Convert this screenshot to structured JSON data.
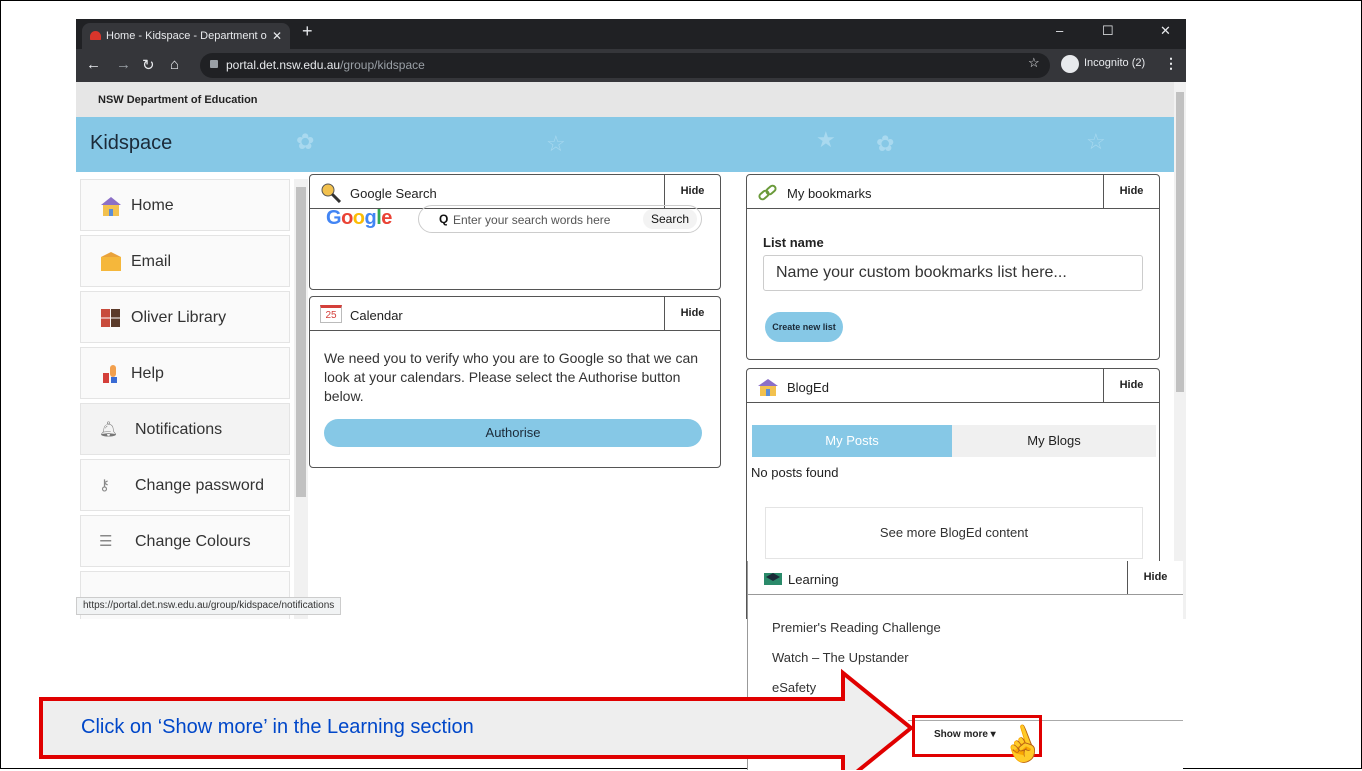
{
  "browser": {
    "tab_title": "Home - Kidspace - Department o",
    "tab_close": "✕",
    "new_tab": "+",
    "url_host": "portal.det.nsw.edu.au",
    "url_path": "/group/kidspace",
    "incognito_label": "Incognito (2)",
    "window_controls": [
      "–",
      "☐",
      "✕"
    ]
  },
  "header": {
    "dept_name": "NSW Department of Education",
    "site_title": "Kidspace"
  },
  "sidebar": {
    "items": [
      {
        "label": "Home",
        "icon": "home-icon"
      },
      {
        "label": "Email",
        "icon": "email-icon"
      },
      {
        "label": "Oliver Library",
        "icon": "library-icon"
      },
      {
        "label": "Help",
        "icon": "help-icon"
      },
      {
        "label": "Notifications",
        "icon": "bell-icon"
      },
      {
        "label": "Change password",
        "icon": "key-icon"
      },
      {
        "label": "Change Colours",
        "icon": "list-icon"
      }
    ]
  },
  "status_url": "https://portal.det.nsw.edu.au/group/kidspace/notifications",
  "google_search": {
    "title": "Google Search",
    "hide": "Hide",
    "logo": "Google",
    "placeholder": "Enter your search words here",
    "button": "Search"
  },
  "calendar": {
    "title": "Calendar",
    "hide": "Hide",
    "icon_number": "25",
    "message": "We need you to verify who you are to Google so that we can look at your calendars. Please select the Authorise button below.",
    "button": "Authorise"
  },
  "bookmarks": {
    "title": "My bookmarks",
    "hide": "Hide",
    "list_label": "List name",
    "placeholder": "Name your custom bookmarks list here...",
    "button": "Create new list"
  },
  "blogged": {
    "title": "BlogEd",
    "hide": "Hide",
    "tab_posts": "My Posts",
    "tab_blogs": "My Blogs",
    "no_posts": "No posts found",
    "see_more": "See more BlogEd content"
  },
  "learning": {
    "title": "Learning",
    "hide": "Hide",
    "links": [
      "Premier's Reading Challenge",
      "Watch – The Upstander",
      "eSafety"
    ],
    "show_more": "Show more ▾"
  },
  "tutorial": {
    "instruction": "Click on ‘Show more’ in the Learning section",
    "accent_color": "#e00000",
    "text_color": "#0047c9"
  }
}
